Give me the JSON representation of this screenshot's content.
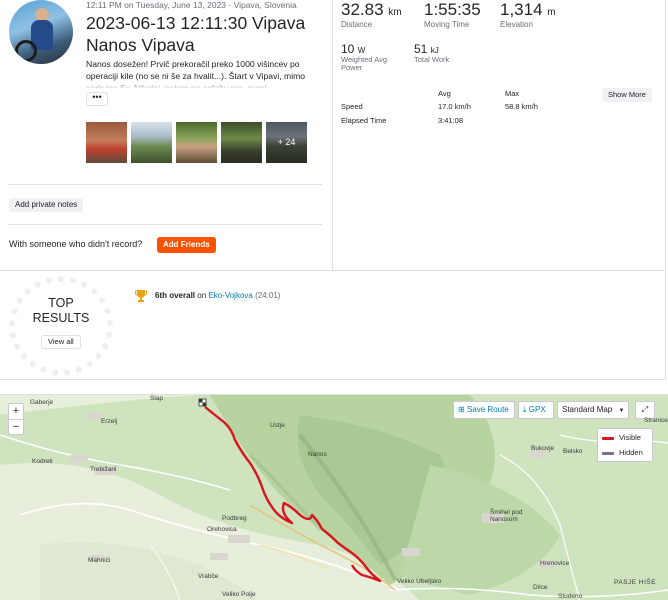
{
  "activity": {
    "meta": "12:11 PM on Tuesday, June 13, 2023 · Vipava, Slovenia",
    "title_line1": "2023-06-13 12:11:30 Vipava",
    "title_line2": "Nanos Vipava",
    "description": "Nanos dosežen! Prvič prekoračil preko 1000 višincev po operaciji kile (no se ni še za hvalit...). Štart v Vipavi, mimo cerkvice Sv. Nikolaj, potem po asfaltu gor, gurni",
    "more_label": "•••",
    "photos_more": "+ 24",
    "private_notes_label": "Add private notes",
    "friends_prompt": "With someone who didn't record?",
    "add_friends_label": "Add Friends"
  },
  "stats": {
    "distance": {
      "value": "32.83",
      "unit": "km",
      "label": "Distance"
    },
    "moving_time": {
      "value": "1:55:35",
      "label": "Moving Time"
    },
    "elevation": {
      "value": "1,314",
      "unit": "m",
      "label": "Elevation"
    },
    "weighted_power": {
      "value": "10",
      "unit": "W",
      "label_1": "Weighted Avg",
      "label_2": "Power"
    },
    "total_work": {
      "value": "51",
      "unit": "kJ",
      "label": "Total Work"
    },
    "table": {
      "col_avg": "Avg",
      "col_max": "Max",
      "speed_label": "Speed",
      "speed_avg": "17.0 km/h",
      "speed_max": "58.8 km/h",
      "elapsed_label": "Elapsed Time",
      "elapsed_avg": "3:41:08"
    },
    "show_more_label": "Show More"
  },
  "top_results": {
    "heading_1": "TOP",
    "heading_2": "RESULTS",
    "view_all_label": "View all",
    "achievement_rank": "6th overall",
    "achievement_on": "on",
    "achievement_segment": "Eko-Vojkova",
    "achievement_time": "(24:01)"
  },
  "map": {
    "zoom_in": "+",
    "zoom_out": "−",
    "save_route_label": "Save Route",
    "gpx_label": "GPX",
    "map_type_label": "Standard Map",
    "legend_visible": "Visible",
    "legend_hidden": "Hidden",
    "visible_color": "#d8141e",
    "hidden_color": "#7a6f8a",
    "places": [
      "Gaberje",
      "Slap",
      "Erzelj",
      "Kodreti",
      "Trebižani",
      "Ustje",
      "Nanos",
      "Podbreg",
      "Orehovica",
      "Bukovje",
      "Belsko",
      "Stranice",
      "Šmihel pod Nanosom",
      "Mahniči",
      "Vrabče",
      "Veliko Ubeljsko",
      "Hrenovice",
      "Dilce",
      "Studeno",
      "Veliko Polje",
      "PASJE HIŠE"
    ]
  }
}
